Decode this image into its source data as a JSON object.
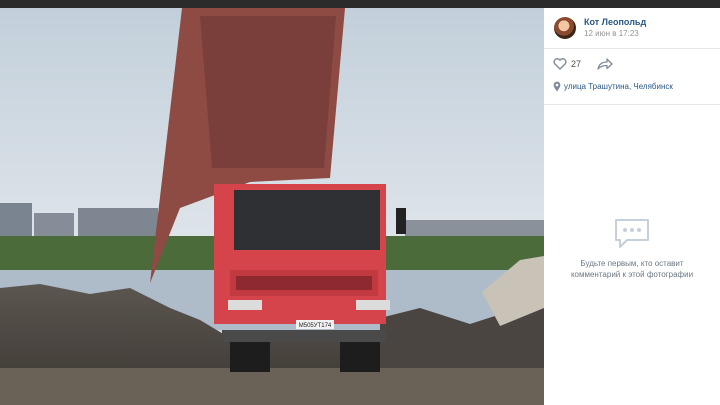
{
  "post": {
    "author_name": "Кот Леопольд",
    "date": "12 июн в 17:23",
    "likes": "27",
    "location": "улица Трашутина, Челябинск"
  },
  "comments": {
    "empty_line1": "Будьте первым, кто оставит",
    "empty_line2": "комментарий к этой фотографии"
  },
  "photo": {
    "plate_text": "М505УТ174"
  },
  "icons": {
    "like": "heart-icon",
    "share": "share-arrow-icon",
    "location": "map-pin-icon",
    "comments": "chat-bubble-icon"
  },
  "colors": {
    "link": "#2a5885",
    "muted": "#939393",
    "icon": "#818c99",
    "truck_red": "#d5444a"
  }
}
